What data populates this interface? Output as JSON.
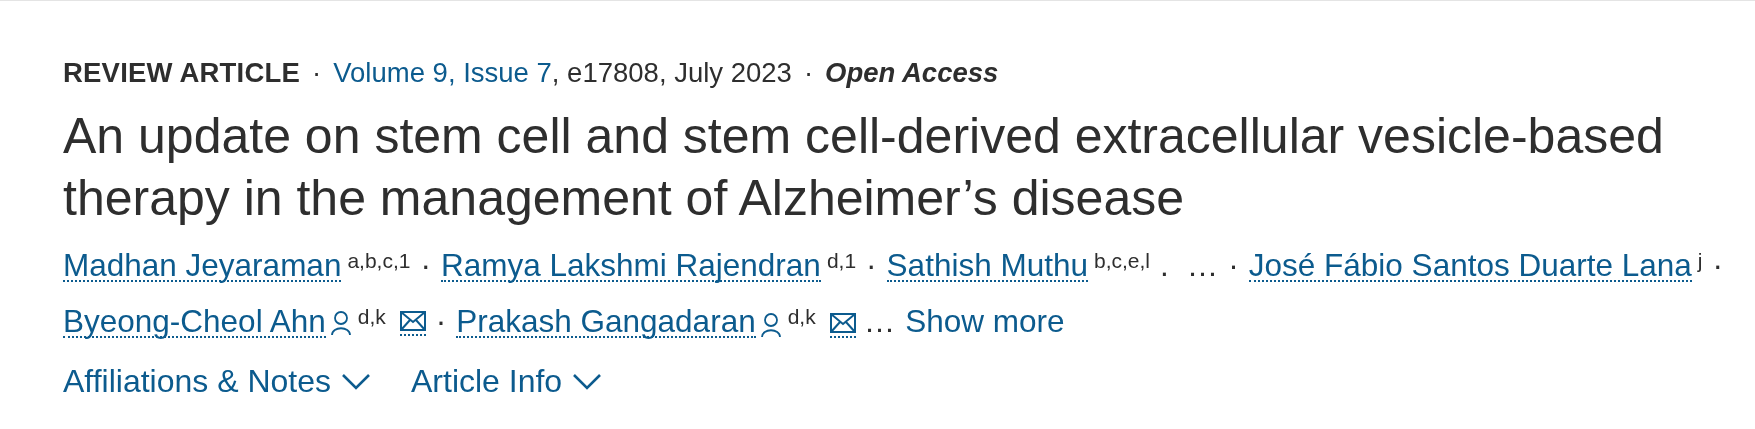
{
  "meta": {
    "article_type": "REVIEW ARTICLE",
    "separator_1": "·",
    "issue_link": "Volume 9, Issue 7",
    "citation": ", e17808, July 2023",
    "separator_2": "·",
    "access": "Open Access"
  },
  "title": "An update on stem cell and stem cell-derived extracellular vesicle-based therapy in the management of Alzheimer’s disease",
  "authors": [
    {
      "kind": "author",
      "name": "Madhan Jeyaraman",
      "affiliations": "a,b,c,1",
      "corresponding": false,
      "email": false,
      "separator": "·"
    },
    {
      "kind": "author",
      "name": "Ramya Lakshmi Rajendran",
      "affiliations": "d,1",
      "corresponding": false,
      "email": false,
      "separator": "·"
    },
    {
      "kind": "author",
      "name": "Sathish Muthu",
      "affiliations": "b,c,e,l",
      "corresponding": false,
      "email": false,
      "separator": "."
    },
    {
      "kind": "ellipsis",
      "text": "…",
      "separator": "·"
    },
    {
      "kind": "author",
      "name": "José Fábio Santos Duarte Lana",
      "affiliations": "j",
      "corresponding": false,
      "email": false,
      "separator": "·"
    },
    {
      "kind": "author",
      "name": "Byeong-Cheol Ahn",
      "affiliations": "d,k",
      "corresponding": true,
      "email": true,
      "separator": "·"
    },
    {
      "kind": "author",
      "name": "Prakash Gangadaran",
      "affiliations": "d,k",
      "corresponding": true,
      "email": true
    },
    {
      "kind": "ellipsis",
      "text": "…"
    },
    {
      "kind": "link",
      "text": "Show more"
    }
  ],
  "toggles": [
    {
      "label": "Affiliations & Notes",
      "expanded": false
    },
    {
      "label": "Article Info",
      "expanded": false
    }
  ]
}
